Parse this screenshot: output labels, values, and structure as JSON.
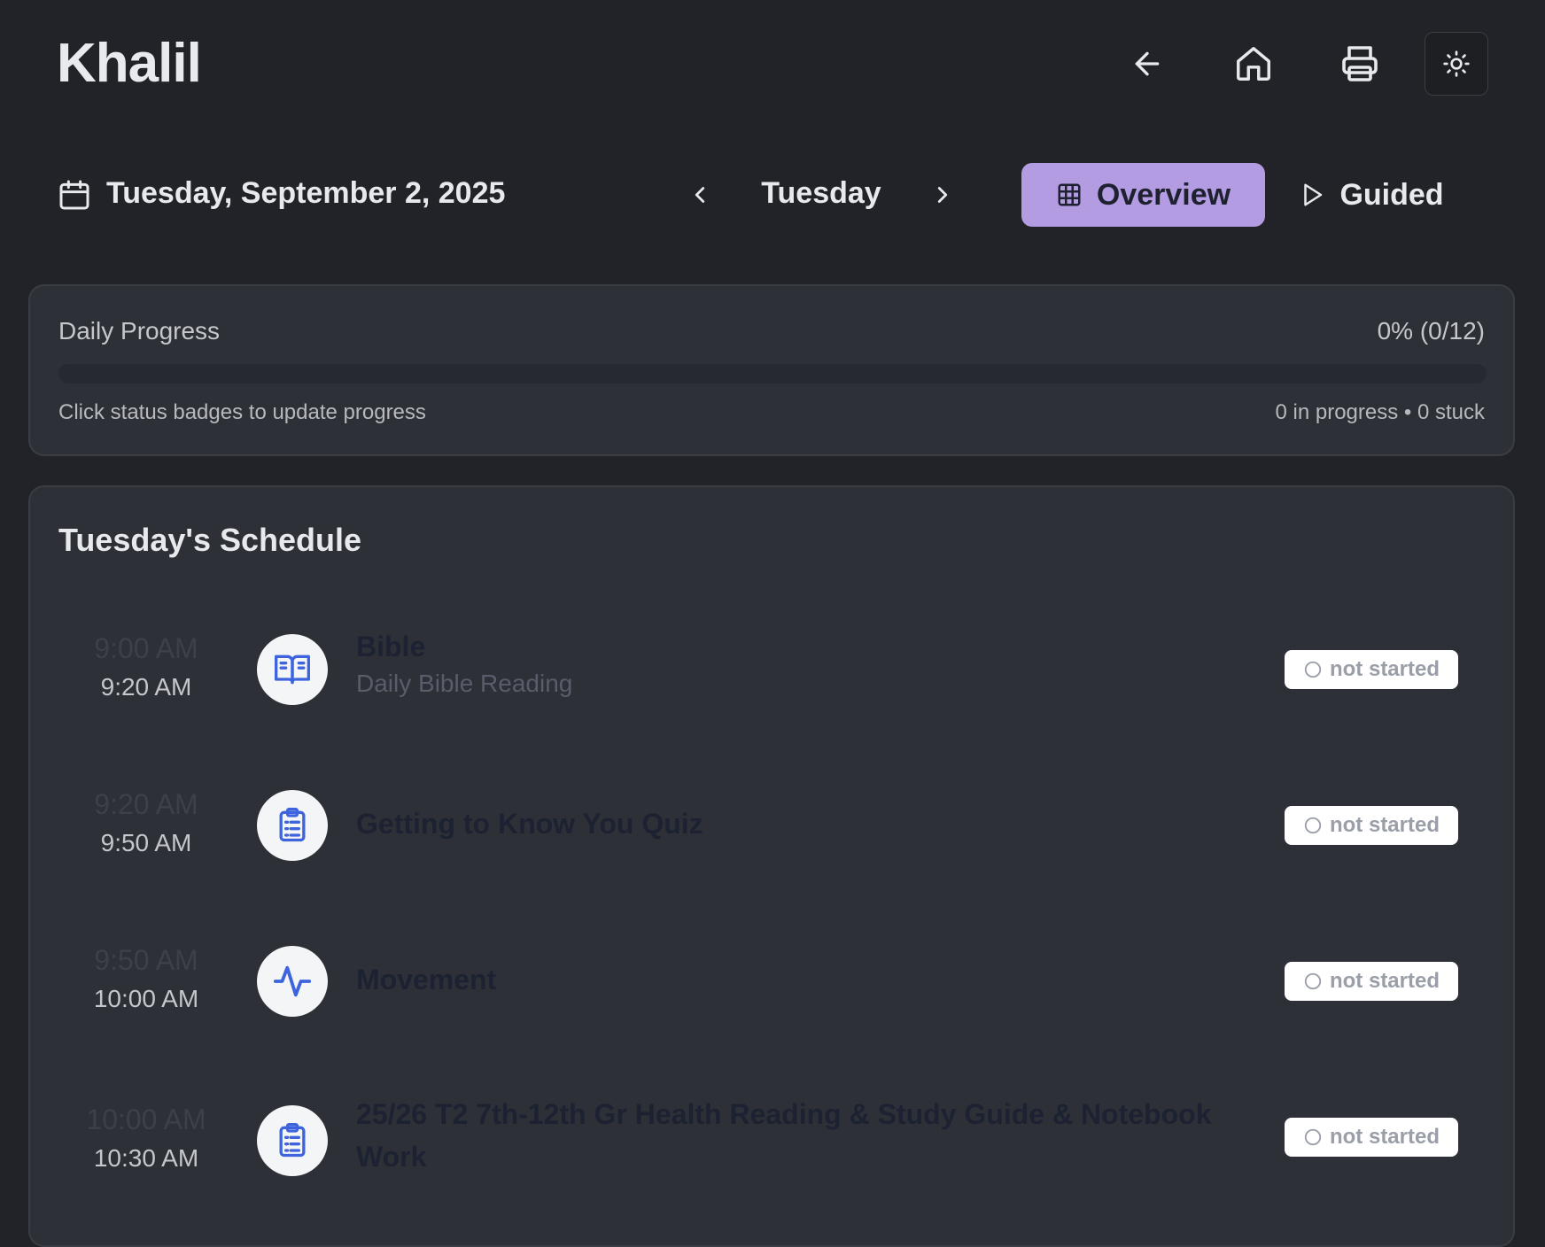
{
  "app": {
    "title": "Khalil"
  },
  "header": {
    "back_icon": "arrow-left-icon",
    "home_icon": "home-icon",
    "print_icon": "printer-icon",
    "theme_icon": "sun-icon"
  },
  "date_bar": {
    "full_date": "Tuesday, September 2, 2025",
    "day_name": "Tuesday",
    "prev_icon": "chevron-left-icon",
    "next_icon": "chevron-right-icon",
    "modes": {
      "overview": "Overview",
      "guided": "Guided",
      "active": "overview"
    }
  },
  "progress": {
    "title": "Daily Progress",
    "value_text": "0% (0/12)",
    "percent": 0,
    "hint": "Click status badges to update progress",
    "stats": "0 in progress • 0 stuck"
  },
  "schedule": {
    "title": "Tuesday's Schedule",
    "items": [
      {
        "start": "9:00 AM",
        "end": "9:20 AM",
        "icon": "open-book-icon",
        "title": "Bible",
        "subtitle": "Daily Bible Reading",
        "status": "not started"
      },
      {
        "start": "9:20 AM",
        "end": "9:50 AM",
        "icon": "clipboard-list-icon",
        "title": "Getting to Know You Quiz",
        "subtitle": "",
        "status": "not started"
      },
      {
        "start": "9:50 AM",
        "end": "10:00 AM",
        "icon": "activity-pulse-icon",
        "title": "Movement",
        "subtitle": "",
        "status": "not started"
      },
      {
        "start": "10:00 AM",
        "end": "10:30 AM",
        "icon": "clipboard-list-icon",
        "title": "25/26 T2 7th-12th Gr Health Reading & Study Guide & Notebook Work",
        "subtitle": "",
        "status": "not started"
      }
    ]
  },
  "colors": {
    "background": "#212328",
    "card": "#2d3037",
    "accent": "#b49ce2",
    "icon_blue": "#3d63dd"
  }
}
